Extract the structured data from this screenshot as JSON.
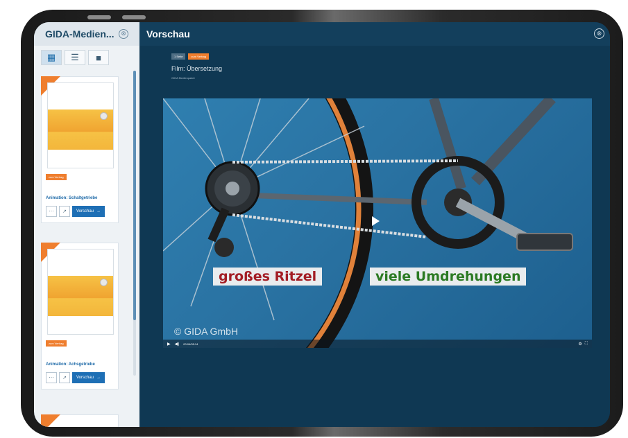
{
  "sidebar": {
    "title": "GIDA-Medien...",
    "close_glyph": "⊗",
    "view_icons": [
      "grid-view-icon",
      "list-view-icon",
      "single-view-icon"
    ],
    "cards": [
      {
        "badge": "zum Vertrag",
        "name": "Animation: Schaltgetriebe",
        "preview_label": "Vorschau"
      },
      {
        "badge": "zum Vertrag",
        "name": "Animation: Achsgetriebe",
        "preview_label": "Vorschau"
      }
    ]
  },
  "main": {
    "title": "Vorschau",
    "close_glyph": "⊗",
    "badges": [
      "1 Seite",
      "zum Vertrag"
    ],
    "film_title": "Film: Übersetzung",
    "film_subtitle": "GIDA Medienpaket"
  },
  "video": {
    "subtitle_left": "großes Ritzel",
    "subtitle_right": "viele Umdrehungen",
    "copyright": "© GIDA GmbH",
    "time": "00:04/05:14",
    "colors": {
      "subtitle_left": "#a31d24",
      "subtitle_right": "#2b7a23"
    }
  }
}
